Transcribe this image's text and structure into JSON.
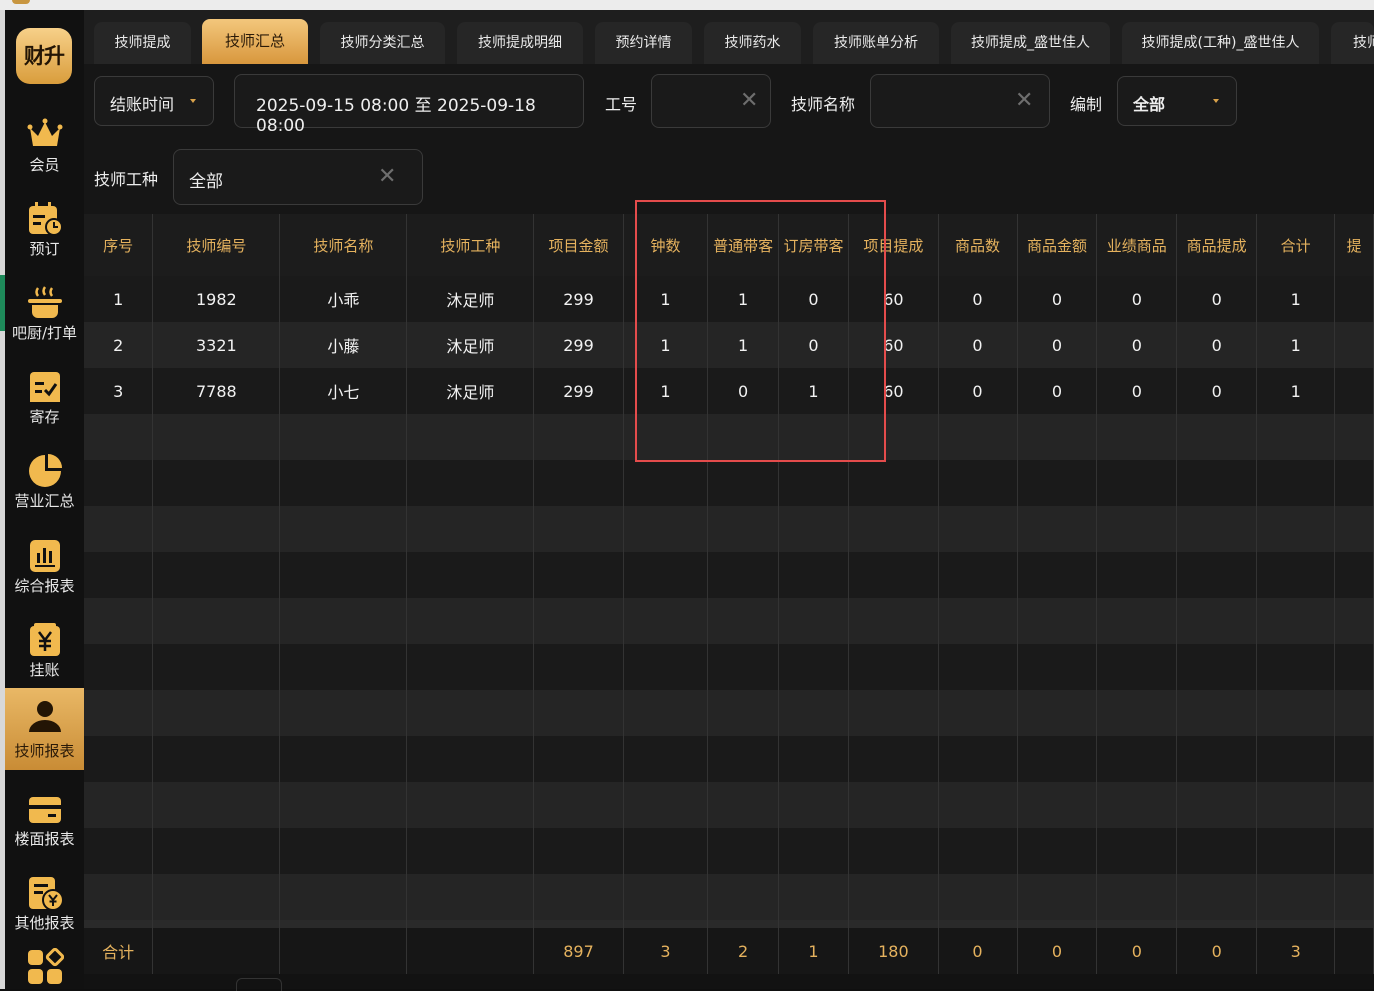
{
  "app": {
    "logo_text": "财升"
  },
  "sidebar": {
    "items": [
      {
        "label": "会员",
        "icon": "crown-icon"
      },
      {
        "label": "预订",
        "icon": "calendar-clock-icon"
      },
      {
        "label": "吧厨/打单",
        "icon": "cooking-pot-icon"
      },
      {
        "label": "寄存",
        "icon": "checklist-icon"
      },
      {
        "label": "营业汇总",
        "icon": "pie-chart-icon"
      },
      {
        "label": "综合报表",
        "icon": "bar-chart-icon"
      },
      {
        "label": "挂账",
        "icon": "yen-doc-icon"
      },
      {
        "label": "技师报表",
        "icon": "user-icon",
        "active": true
      },
      {
        "label": "楼面报表",
        "icon": "card-icon"
      },
      {
        "label": "其他报表",
        "icon": "yen-report-icon"
      },
      {
        "label": "",
        "icon": "apps-grid-icon"
      }
    ]
  },
  "tabs": [
    {
      "label": "技师提成"
    },
    {
      "label": "技师汇总",
      "active": true
    },
    {
      "label": "技师分类汇总"
    },
    {
      "label": "技师提成明细"
    },
    {
      "label": "预约详情"
    },
    {
      "label": "技师药水"
    },
    {
      "label": "技师账单分析"
    },
    {
      "label": "技师提成_盛世佳人"
    },
    {
      "label": "技师提成(工种)_盛世佳人"
    },
    {
      "label": "技师"
    }
  ],
  "filters": {
    "time_type": "结账时间",
    "date_range": "2025-09-15 08:00 至 2025-09-18 08:00",
    "staff_no_label": "工号",
    "staff_no_value": "",
    "staff_name_label": "技师名称",
    "staff_name_value": "",
    "org_label": "编制",
    "org_value": "全部",
    "type_label": "技师工种",
    "type_value": "全部"
  },
  "table": {
    "headers": [
      "序号",
      "技师编号",
      "技师名称",
      "技师工种",
      "项目金额",
      "钟数",
      "普通带客",
      "订房带客",
      "项目提成",
      "商品数",
      "商品金额",
      "业绩商品",
      "商品提成",
      "合计",
      "提"
    ],
    "rows": [
      [
        "1",
        "1982",
        "小乖",
        "沐足师",
        "299",
        "1",
        "1",
        "0",
        "60",
        "0",
        "0",
        "0",
        "0",
        "1",
        ""
      ],
      [
        "2",
        "3321",
        "小藤",
        "沐足师",
        "299",
        "1",
        "1",
        "0",
        "60",
        "0",
        "0",
        "0",
        "0",
        "1",
        ""
      ],
      [
        "3",
        "7788",
        "小七",
        "沐足师",
        "299",
        "1",
        "0",
        "1",
        "60",
        "0",
        "0",
        "0",
        "0",
        "1",
        ""
      ]
    ],
    "empty_rows": 11,
    "totals": [
      "合计",
      "",
      "",
      "",
      "897",
      "3",
      "2",
      "1",
      "180",
      "0",
      "0",
      "0",
      "0",
      "3",
      ""
    ]
  },
  "colors": {
    "accent": "#e5b25e",
    "highlight_box": "#e44c4c",
    "active_tab": "#e9b866"
  }
}
